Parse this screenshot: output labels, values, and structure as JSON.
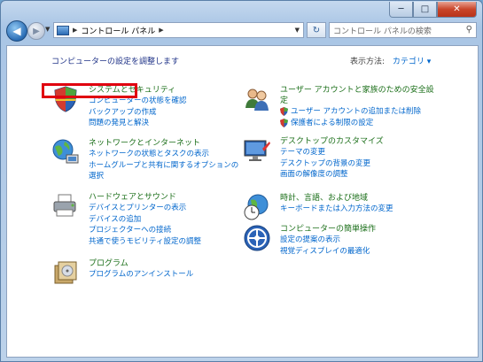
{
  "window": {
    "caption_buttons": {
      "minimize": "─",
      "maximize": "□",
      "close": "✕"
    }
  },
  "nav": {
    "back_glyph": "◀",
    "forward_glyph": "▶",
    "breadcrumb": [
      "コントロール パネル"
    ],
    "search_placeholder": "コントロール パネルの検索",
    "refresh_glyph": "↻",
    "search_glyph": "⚲"
  },
  "content": {
    "heading": "コンピューターの設定を調整します",
    "view_by_label": "表示方法:",
    "view_by_value": "カテゴリ ▾",
    "categories_left": [
      {
        "title": "システムとセキュリティ",
        "links": [
          "コンピューターの状態を確認",
          "バックアップの作成",
          "問題の発見と解決"
        ],
        "icon": "shield-icon"
      },
      {
        "title": "ネットワークとインターネット",
        "links": [
          "ネットワークの状態とタスクの表示",
          "ホームグループと共有に関するオプションの",
          "選択"
        ],
        "icon": "network-globe-icon"
      },
      {
        "title": "ハードウェアとサウンド",
        "links": [
          "デバイスとプリンターの表示",
          "デバイスの追加",
          "プロジェクターへの接続",
          "共通で使うモビリティ設定の調整"
        ],
        "icon": "printer-icon"
      },
      {
        "title": "プログラム",
        "links": [
          "プログラムのアンインストール"
        ],
        "icon": "programs-icon"
      }
    ],
    "categories_right": [
      {
        "title": "ユーザー アカウントと家族のための安全設",
        "title2": "定",
        "links": [
          "ユーザー アカウントの追加または削除",
          "保護者による制限の設定"
        ],
        "icon": "users-icon"
      },
      {
        "title": "デスクトップのカスタマイズ",
        "links": [
          "テーマの変更",
          "デスクトップの背景の変更",
          "画面の解像度の調整"
        ],
        "icon": "desktop-icon"
      },
      {
        "title": "時計、言語、および地域",
        "links": [
          "キーボードまたは入力方法の変更"
        ],
        "icon": "clock-globe-icon"
      },
      {
        "title": "コンピューターの簡単操作",
        "links": [
          "設定の提案の表示",
          "視覚ディスプレイの最適化"
        ],
        "icon": "ease-of-access-icon"
      }
    ]
  }
}
